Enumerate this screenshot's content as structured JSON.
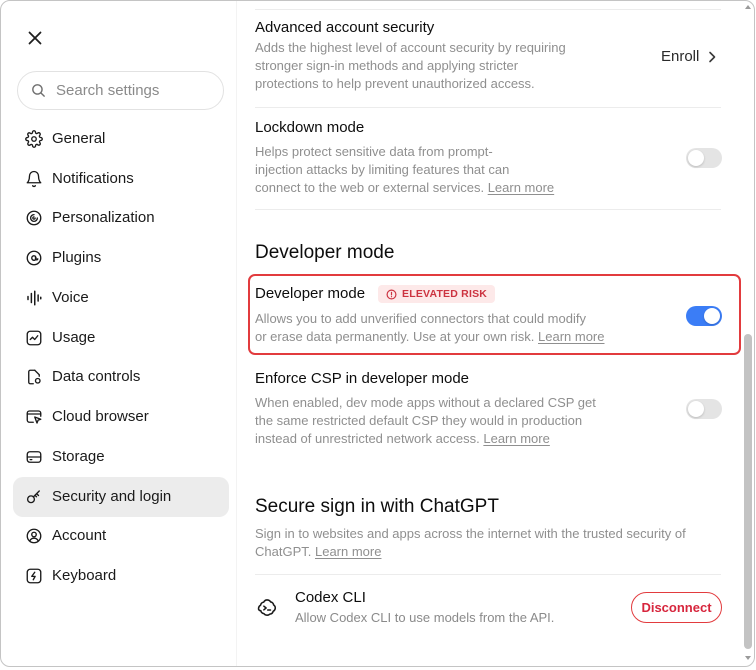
{
  "window": {
    "close_icon": "close-icon"
  },
  "sidebar": {
    "search": {
      "placeholder": "Search settings",
      "value": "",
      "icon": "search-icon"
    },
    "items": [
      {
        "label": "General",
        "icon": "gear-icon",
        "selected": false
      },
      {
        "label": "Notifications",
        "icon": "bell-icon",
        "selected": false
      },
      {
        "label": "Personalization",
        "icon": "personalization-icon",
        "selected": false
      },
      {
        "label": "Plugins",
        "icon": "plugins-icon",
        "selected": false
      },
      {
        "label": "Voice",
        "icon": "voice-waveform-icon",
        "selected": false
      },
      {
        "label": "Usage",
        "icon": "usage-chart-icon",
        "selected": false
      },
      {
        "label": "Data controls",
        "icon": "data-controls-icon",
        "selected": false
      },
      {
        "label": "Cloud browser",
        "icon": "cloud-browser-icon",
        "selected": false
      },
      {
        "label": "Storage",
        "icon": "storage-icon",
        "selected": false
      },
      {
        "label": "Security and login",
        "icon": "key-icon",
        "selected": true
      },
      {
        "label": "Account",
        "icon": "account-icon",
        "selected": false
      },
      {
        "label": "Keyboard",
        "icon": "keyboard-icon",
        "selected": false
      }
    ]
  },
  "content": {
    "advanced_security": {
      "title": "Advanced account security",
      "description": "Adds the highest level of account security by requiring\nstronger sign-in methods and applying stricter\nprotections to help prevent unauthorized access.",
      "action_label": "Enroll",
      "action_icon": "chevron-right-icon"
    },
    "lockdown": {
      "title": "Lockdown mode",
      "description": "Helps protect sensitive data from prompt-\ninjection attacks by limiting features that can\nconnect to the web or external services.",
      "learn_more": "Learn more",
      "enabled": false
    },
    "developer_section": {
      "heading": "Developer mode"
    },
    "developer_mode": {
      "title": "Developer mode",
      "badge": "ELEVATED RISK",
      "badge_icon": "warning-circle-icon",
      "description": "Allows you to add unverified connectors that could modify\nor erase data permanently. Use at your own risk.",
      "learn_more": "Learn more",
      "enabled": true
    },
    "enforce_csp": {
      "title": "Enforce CSP in developer mode",
      "description": "When enabled, dev mode apps without a declared CSP get\nthe same restricted default CSP they would in production\ninstead of unrestricted network access.",
      "learn_more": "Learn more",
      "enabled": false
    },
    "secure_sign_in": {
      "heading": "Secure sign in with ChatGPT",
      "description": "Sign in to websites and apps across the internet with the trusted security of\nChatGPT.",
      "learn_more": "Learn more"
    },
    "codex_cli": {
      "icon": "codex-icon",
      "title": "Codex CLI",
      "description": "Allow Codex CLI to use models from the API.",
      "button_label": "Disconnect"
    }
  },
  "colors": {
    "toggle_on": "#3b7df6",
    "toggle_off": "#e4e4e4",
    "danger": "#d7263d",
    "danger_border": "#e23b3e",
    "badge_bg": "#fde9e9",
    "badge_text": "#cc3340",
    "selected_nav_bg": "#ececec",
    "secondary_text": "#8f8f8f"
  }
}
